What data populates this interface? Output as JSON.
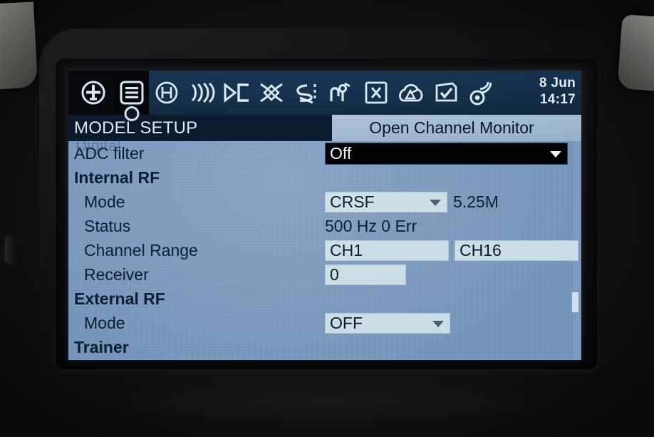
{
  "device": {
    "name": "rc-transmitter-lcd"
  },
  "toolbar": {
    "icons": [
      {
        "name": "model-select-icon",
        "label": "Model Select"
      },
      {
        "name": "model-setup-icon",
        "label": "Model Setup",
        "selected": true
      },
      {
        "name": "heli-setup-icon",
        "label": "Heli Setup"
      },
      {
        "name": "flight-modes-icon",
        "label": "Flight Modes"
      },
      {
        "name": "inputs-icon",
        "label": "Inputs"
      },
      {
        "name": "mixer-icon",
        "label": "Mixer"
      },
      {
        "name": "outputs-icon",
        "label": "Outputs"
      },
      {
        "name": "curves-icon",
        "label": "Curves"
      },
      {
        "name": "global-variables-icon",
        "label": "Global Variables"
      },
      {
        "name": "logical-switches-icon",
        "label": "Logical Switches"
      },
      {
        "name": "special-functions-icon",
        "label": "Special Functions"
      },
      {
        "name": "telemetry-icon",
        "label": "Telemetry"
      }
    ],
    "date": "8 Jun",
    "time": "14:17"
  },
  "titlebar": {
    "screen_title": "MODEL SETUP",
    "action_label": "Open Channel Monitor"
  },
  "list": {
    "ghost_row_text": "Digital",
    "rows": [
      {
        "name": "adc-filter",
        "label": "ADC filter",
        "indent": 0,
        "bold": false,
        "widget": "combo-selected",
        "value": "Off"
      },
      {
        "name": "internal-rf-header",
        "label": "Internal RF",
        "indent": 0,
        "bold": true,
        "widget": "none",
        "value": ""
      },
      {
        "name": "internal-rf-mode",
        "label": "Mode",
        "indent": 1,
        "bold": false,
        "widget": "combo",
        "value": "CRSF",
        "suffix": "5.25M"
      },
      {
        "name": "internal-rf-status",
        "label": "Status",
        "indent": 1,
        "bold": false,
        "widget": "text",
        "value": "500 Hz 0 Err"
      },
      {
        "name": "internal-rf-channel-range",
        "label": "Channel Range",
        "indent": 1,
        "bold": false,
        "widget": "two-boxes",
        "value": "CH1",
        "value2": "CH16"
      },
      {
        "name": "internal-rf-receiver",
        "label": "Receiver",
        "indent": 1,
        "bold": false,
        "widget": "box-small",
        "value": "0"
      },
      {
        "name": "external-rf-header",
        "label": "External RF",
        "indent": 0,
        "bold": true,
        "widget": "none",
        "value": ""
      },
      {
        "name": "external-rf-mode",
        "label": "Mode",
        "indent": 1,
        "bold": false,
        "widget": "combo-ext",
        "value": "OFF"
      },
      {
        "name": "trainer-header",
        "label": "Trainer",
        "indent": 0,
        "bold": true,
        "widget": "none",
        "value": ""
      }
    ]
  },
  "colors": {
    "lcd_background": "#7e9dc3",
    "toolbar_background": "#17304a",
    "title_dark": "#0c1a2c",
    "title_light": "#9ab5d1",
    "field_background": "#ccdfe9",
    "selected_background": "#010102",
    "text_dark": "#0d1d30",
    "text_light": "#dce9f6"
  }
}
